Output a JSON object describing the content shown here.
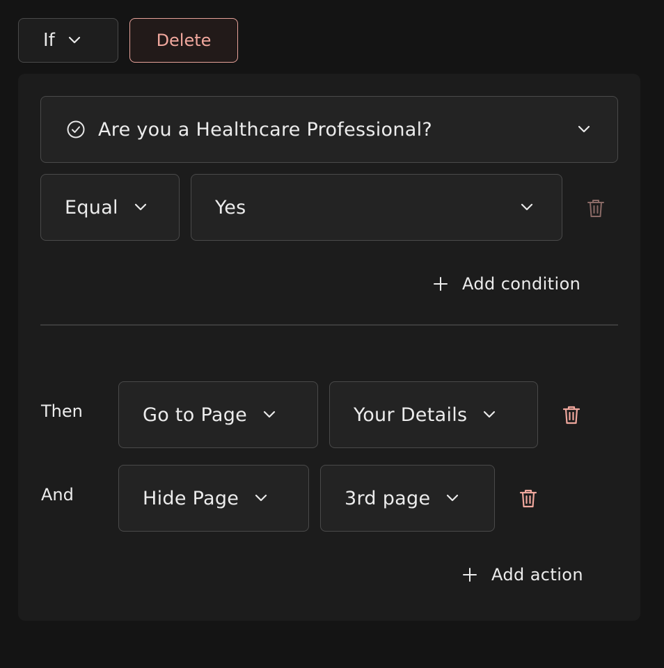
{
  "header": {
    "if_label": "If",
    "delete_label": "Delete"
  },
  "condition": {
    "question": "Are you a Healthcare Professional?",
    "operator": "Equal",
    "value": "Yes",
    "add_condition_label": "Add condition"
  },
  "actions": [
    {
      "prefix": "Then",
      "action": "Go to Page",
      "target": "Your Details"
    },
    {
      "prefix": "And",
      "action": "Hide Page",
      "target": "3rd page"
    }
  ],
  "add_action_label": "Add action",
  "colors": {
    "background": "#141414",
    "panel": "#1c1c1c",
    "field": "#232323",
    "border": "#4a4a4a",
    "delete_accent": "#f0a79d",
    "trash_active": "#f0a79d",
    "trash_muted": "#8a6a66"
  }
}
